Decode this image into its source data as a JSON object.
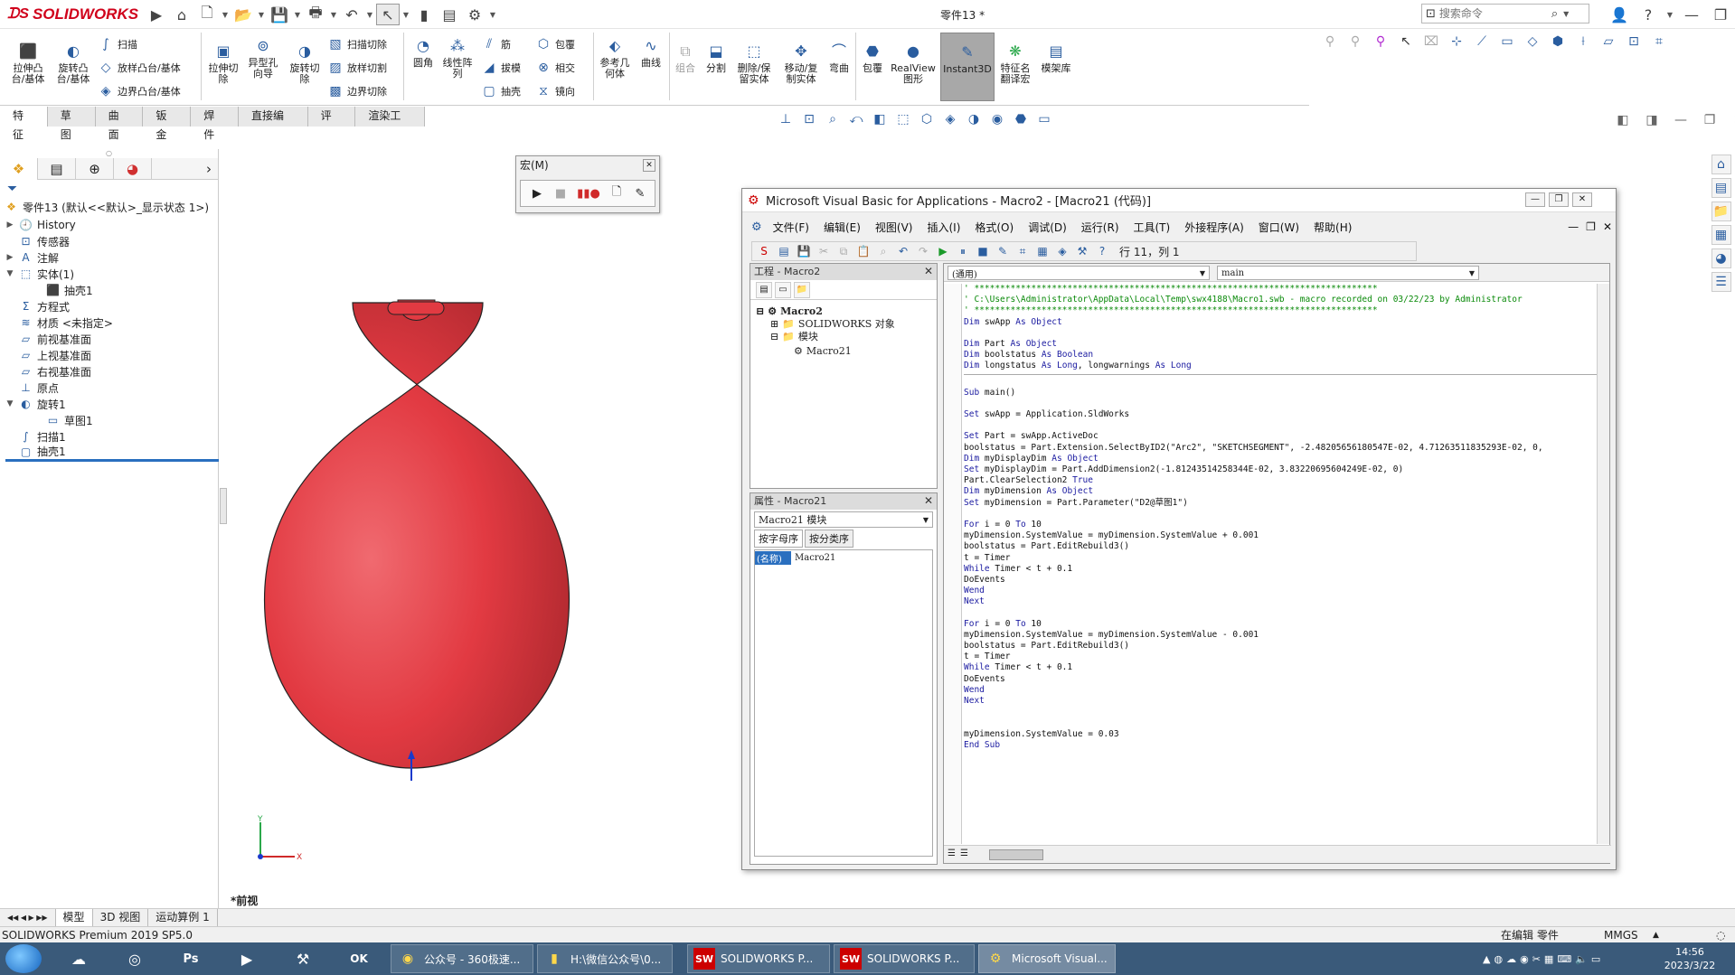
{
  "app": {
    "logo_text": "SOLIDWORKS",
    "doc_title": "零件13 *",
    "search_placeholder": "搜索命令"
  },
  "ribbon": {
    "groups_col1": [
      {
        "label": "拉伸凸\n台/基体"
      },
      {
        "label": "旋转凸\n台/基体"
      }
    ],
    "small_col1": [
      "扫描",
      "放样凸台/基体",
      "边界凸台/基体"
    ],
    "groups_col2": [
      {
        "label": "拉伸切\n除"
      },
      {
        "label": "异型孔\n向导"
      },
      {
        "label": "旋转切\n除"
      }
    ],
    "small_col2": [
      "扫描切除",
      "放样切割",
      "边界切除"
    ],
    "groups_col3": [
      {
        "label": "圆角"
      },
      {
        "label": "线性阵\n列"
      }
    ],
    "small_col3": [
      "筋",
      "拔模",
      "抽壳"
    ],
    "small_col4": [
      "包覆",
      "相交",
      "镜向"
    ],
    "groups_col5": [
      {
        "label": "参考几\n何体"
      },
      {
        "label": "曲线"
      },
      {
        "label": "组合"
      },
      {
        "label": "分割"
      },
      {
        "label": "删除/保\n留实体"
      },
      {
        "label": "移动/复\n制实体"
      },
      {
        "label": "弯曲"
      },
      {
        "label": "包覆"
      },
      {
        "label": "RealView\n图形"
      },
      {
        "label": "Instant3D"
      },
      {
        "label": "特征名\n翻译宏"
      },
      {
        "label": "模架库"
      }
    ]
  },
  "tabs": [
    "特征",
    "草图",
    "曲面",
    "钣金",
    "焊件",
    "直接编辑",
    "评估",
    "渲染工具"
  ],
  "active_tab": 0,
  "tree": {
    "root": "零件13 (默认<<默认>_显示状态 1>)",
    "items": [
      {
        "label": "History",
        "icon": "history-icon",
        "exp": "▶"
      },
      {
        "label": "传感器",
        "icon": "sensor-icon",
        "exp": ""
      },
      {
        "label": "注解",
        "icon": "annotation-icon",
        "exp": "▶"
      },
      {
        "label": "实体(1)",
        "icon": "solid-body-icon",
        "exp": "▼"
      },
      {
        "label": "抽壳1",
        "icon": "shell-body-icon",
        "exp": "",
        "indent": 1
      },
      {
        "label": "方程式",
        "icon": "equation-icon",
        "exp": ""
      },
      {
        "label": "材质 <未指定>",
        "icon": "material-icon",
        "exp": ""
      },
      {
        "label": "前视基准面",
        "icon": "plane-icon",
        "exp": ""
      },
      {
        "label": "上视基准面",
        "icon": "plane-icon",
        "exp": ""
      },
      {
        "label": "右视基准面",
        "icon": "plane-icon",
        "exp": ""
      },
      {
        "label": "原点",
        "icon": "origin-icon",
        "exp": ""
      },
      {
        "label": "旋转1",
        "icon": "revolve-icon",
        "exp": "▼"
      },
      {
        "label": "草图1",
        "icon": "sketch-icon",
        "exp": "",
        "indent": 1
      },
      {
        "label": "扫描1",
        "icon": "sweep-icon",
        "exp": ""
      },
      {
        "label": "抽壳1",
        "icon": "shell-icon",
        "exp": "",
        "selected": true
      }
    ]
  },
  "macro_toolbar": {
    "title": "宏(M)"
  },
  "vba": {
    "title": "Microsoft Visual Basic for Applications - Macro2 - [Macro21 (代码)]",
    "menu": [
      "文件(F)",
      "编辑(E)",
      "视图(V)",
      "插入(I)",
      "格式(O)",
      "调试(D)",
      "运行(R)",
      "工具(T)",
      "外接程序(A)",
      "窗口(W)",
      "帮助(H)"
    ],
    "position": "行 11，列 1",
    "project_title": "工程 - Macro2",
    "project_root": "Macro2",
    "project_folder1": "SOLIDWORKS 对象",
    "project_folder2": "模块",
    "project_module": "Macro21",
    "props_title": "属性 - Macro21",
    "props_select": "Macro21 模块",
    "props_tab1": "按字母序",
    "props_tab2": "按分类序",
    "props_key": "(名称)",
    "props_value": "Macro21",
    "code_left_dd": "(通用)",
    "code_right_dd": "main",
    "code_lines": [
      {
        "t": "' ******************************************************************************",
        "c": "cm"
      },
      {
        "t": "' C:\\Users\\Administrator\\AppData\\Local\\Temp\\swx4188\\Macro1.swb - macro recorded on 03/22/23 by Administrator",
        "c": "cm"
      },
      {
        "t": "' ******************************************************************************",
        "c": "cm"
      },
      {
        "t": "Dim swApp As Object",
        "c": ""
      },
      {
        "t": "",
        "c": ""
      },
      {
        "t": "Dim Part As Object",
        "c": ""
      },
      {
        "t": "Dim boolstatus As Boolean",
        "c": ""
      },
      {
        "t": "Dim longstatus As Long, longwarnings As Long",
        "c": ""
      },
      {
        "t": "",
        "c": ""
      },
      {
        "t": "Sub main()",
        "c": ""
      },
      {
        "t": "",
        "c": ""
      },
      {
        "t": "Set swApp = Application.SldWorks",
        "c": ""
      },
      {
        "t": "",
        "c": ""
      },
      {
        "t": "Set Part = swApp.ActiveDoc",
        "c": ""
      },
      {
        "t": "boolstatus = Part.Extension.SelectByID2(\"Arc2\", \"SKETCHSEGMENT\", -2.48205656180547E-02, 4.71263511835293E-02, 0,",
        "c": ""
      },
      {
        "t": "Dim myDisplayDim As Object",
        "c": ""
      },
      {
        "t": "Set myDisplayDim = Part.AddDimension2(-1.81243514258344E-02, 3.83220695604249E-02, 0)",
        "c": ""
      },
      {
        "t": "Part.ClearSelection2 True",
        "c": ""
      },
      {
        "t": "Dim myDimension As Object",
        "c": ""
      },
      {
        "t": "Set myDimension = Part.Parameter(\"D2@草图1\")",
        "c": ""
      },
      {
        "t": "",
        "c": ""
      },
      {
        "t": "For i = 0 To 10",
        "c": ""
      },
      {
        "t": "myDimension.SystemValue = myDimension.SystemValue + 0.001",
        "c": ""
      },
      {
        "t": "boolstatus = Part.EditRebuild3()",
        "c": ""
      },
      {
        "t": "t = Timer",
        "c": ""
      },
      {
        "t": "While Timer < t + 0.1",
        "c": ""
      },
      {
        "t": "DoEvents",
        "c": ""
      },
      {
        "t": "Wend",
        "c": ""
      },
      {
        "t": "Next",
        "c": ""
      },
      {
        "t": "",
        "c": ""
      },
      {
        "t": "For i = 0 To 10",
        "c": ""
      },
      {
        "t": "myDimension.SystemValue = myDimension.SystemValue - 0.001",
        "c": ""
      },
      {
        "t": "boolstatus = Part.EditRebuild3()",
        "c": ""
      },
      {
        "t": "t = Timer",
        "c": ""
      },
      {
        "t": "While Timer < t + 0.1",
        "c": ""
      },
      {
        "t": "DoEvents",
        "c": ""
      },
      {
        "t": "Wend",
        "c": ""
      },
      {
        "t": "Next",
        "c": ""
      },
      {
        "t": "",
        "c": ""
      },
      {
        "t": "",
        "c": ""
      },
      {
        "t": "myDimension.SystemValue = 0.03",
        "c": ""
      },
      {
        "t": "End Sub",
        "c": ""
      }
    ]
  },
  "viewport": {
    "view_label": "*前视",
    "balloon_color": "#e8323c"
  },
  "bottom_tabs": [
    "模型",
    "3D 视图",
    "运动算例 1"
  ],
  "status": {
    "left": "SOLIDWORKS Premium 2019 SP5.0",
    "editing": "在编辑 零件",
    "units": "MMGS"
  },
  "taskbar": {
    "apps": [
      {
        "label": "公众号 - 360极速...",
        "icon": "360-browser-icon"
      },
      {
        "label": "H:\\微信公众号\\0...",
        "icon": "folder-icon"
      },
      {
        "label": "SOLIDWORKS P...",
        "icon": "solidworks-icon"
      },
      {
        "label": "SOLIDWORKS P...",
        "icon": "solidworks-icon"
      },
      {
        "label": "Microsoft Visual...",
        "icon": "vba-icon"
      }
    ],
    "time": "14:56",
    "date": "2023/3/22"
  }
}
